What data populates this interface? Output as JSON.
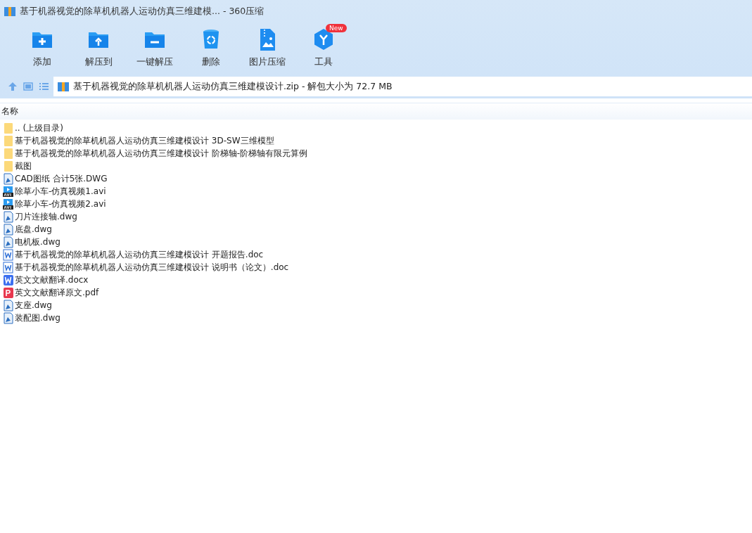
{
  "window": {
    "title": "基于机器视觉的除草机机器人运动仿真三维建模... - 360压缩"
  },
  "toolbar": [
    {
      "kind": "add",
      "label": "添加"
    },
    {
      "kind": "extract",
      "label": "解压到"
    },
    {
      "kind": "quick",
      "label": "一键解压"
    },
    {
      "kind": "delete",
      "label": "删除"
    },
    {
      "kind": "image",
      "label": "图片压缩"
    },
    {
      "kind": "tools",
      "label": "工具",
      "badge": "New"
    }
  ],
  "path_bar": {
    "path": "基于机器视觉的除草机机器人运动仿真三维建模设计.zip - 解包大小为 72.7 MB"
  },
  "file_list": {
    "columns": [
      "名称"
    ],
    "rows": [
      {
        "kind": "folder",
        "name": ".. (上级目录)"
      },
      {
        "kind": "folder",
        "name": "基于机器视觉的除草机机器人运动仿真三维建模设计 3D-SW三维模型"
      },
      {
        "kind": "folder",
        "name": "基于机器视觉的除草机机器人运动仿真三维建模设计 阶梯轴-阶梯轴有限元算例"
      },
      {
        "kind": "folder",
        "name": "截图"
      },
      {
        "kind": "dwg",
        "name": "CAD图纸 合计5张.DWG"
      },
      {
        "kind": "avi",
        "name": "除草小车-仿真视频1.avi"
      },
      {
        "kind": "avi",
        "name": "除草小车-仿真视频2.avi"
      },
      {
        "kind": "dwg",
        "name": "刀片连接轴.dwg"
      },
      {
        "kind": "dwg",
        "name": "底盘.dwg"
      },
      {
        "kind": "dwg",
        "name": "电机板.dwg"
      },
      {
        "kind": "doc",
        "name": "基于机器视觉的除草机机器人运动仿真三维建模设计 开题报告.doc"
      },
      {
        "kind": "doc",
        "name": "基于机器视觉的除草机机器人运动仿真三维建模设计 说明书（论文）.doc"
      },
      {
        "kind": "docx",
        "name": "英文文献翻译.docx"
      },
      {
        "kind": "pdf",
        "name": "英文文献翻译原文.pdf"
      },
      {
        "kind": "dwg",
        "name": "支座.dwg"
      },
      {
        "kind": "dwg",
        "name": "装配图.dwg"
      }
    ]
  }
}
